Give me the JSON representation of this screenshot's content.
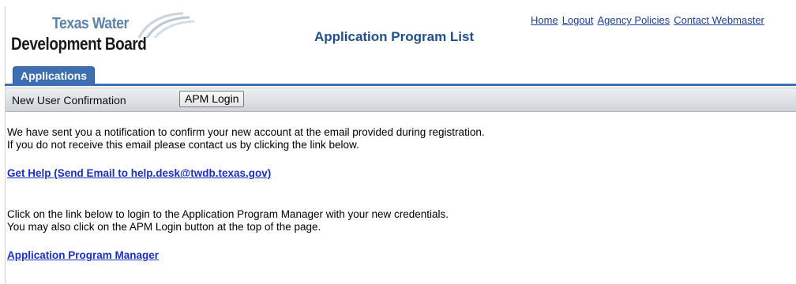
{
  "logo": {
    "line1": "Texas Water",
    "line2": "Development Board"
  },
  "header": {
    "title": "Application Program List",
    "links": [
      "Home",
      "Logout",
      "Agency Policies",
      "Contact Webmaster"
    ]
  },
  "tabs": {
    "active": "Applications"
  },
  "toolbar": {
    "title": "New User Confirmation",
    "apm_login_label": "APM Login"
  },
  "content": {
    "para1_line1": "We have sent you a notification to confirm your new account at the email provided during registration.",
    "para1_line2": "If you do not receive this email please contact us by clicking the link below.",
    "help_link": "Get Help (Send Email to help.desk@twdb.texas.gov)",
    "para2_line1": "Click on the link below to login to the Application Program Manager with your new credentials.",
    "para2_line2": "You may also click on the APM Login button at the top of the page.",
    "apm_link": "Application Program Manager"
  },
  "colors": {
    "tab_blue": "#3f6fb3",
    "title_blue": "#1f4f8f",
    "link_blue": "#1a2ec4"
  }
}
